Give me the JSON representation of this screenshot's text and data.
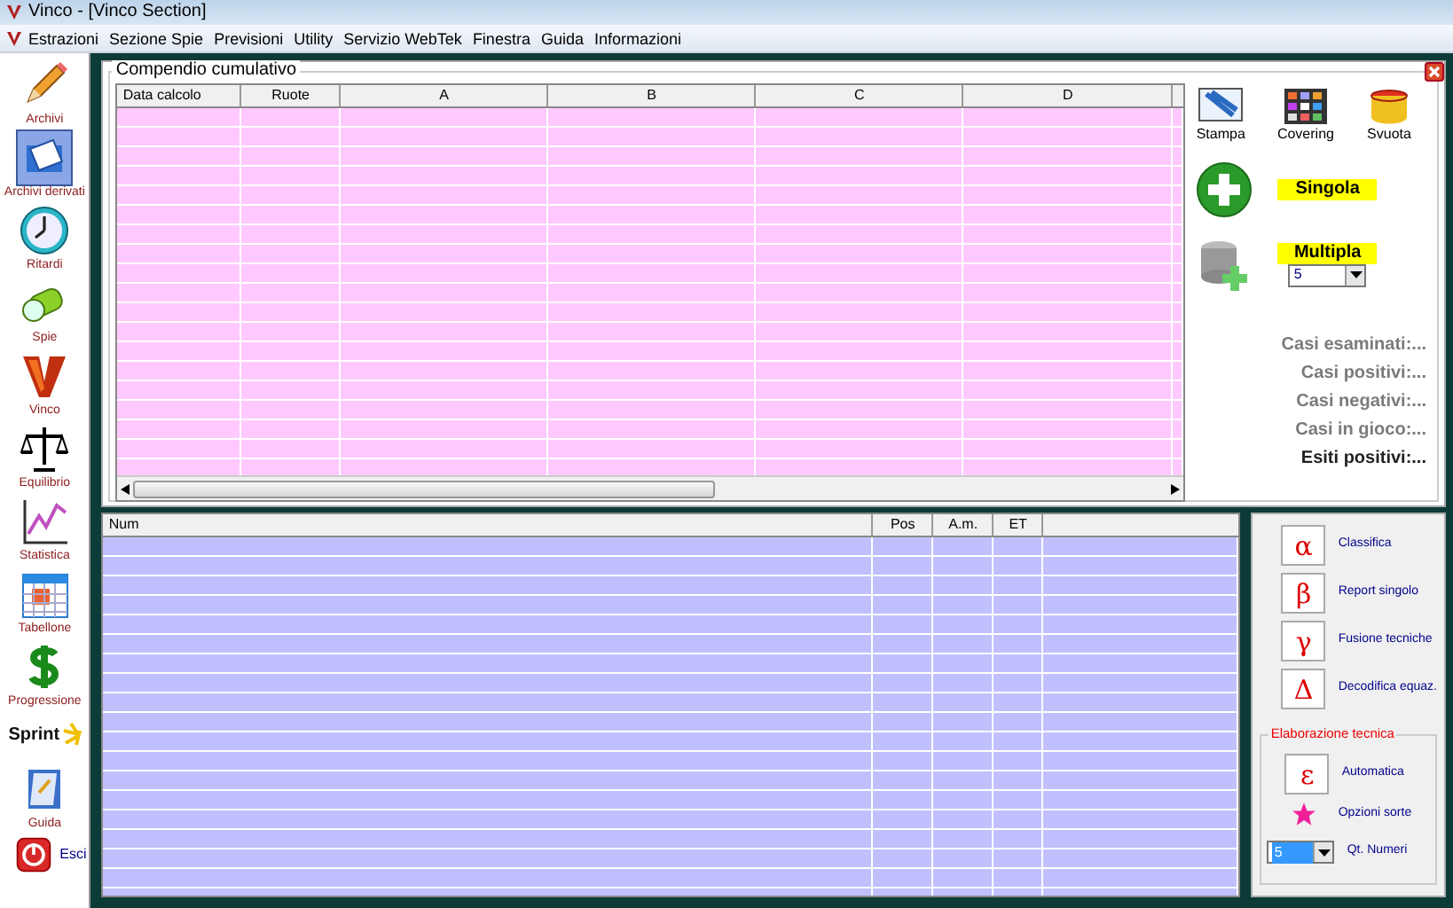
{
  "window": {
    "title": "Vinco - [Vinco Section]"
  },
  "menu": [
    "Estrazioni",
    "Sezione Spie",
    "Previsioni",
    "Utility",
    "Servizio WebTek",
    "Finestra",
    "Guida",
    "Informazioni"
  ],
  "sidebar": {
    "items": [
      {
        "label": "Archivi",
        "selected": false,
        "kind": "stacked"
      },
      {
        "label": "Archivi derivati",
        "selected": true,
        "kind": "stacked"
      },
      {
        "label": "Ritardi",
        "selected": false,
        "kind": "stacked"
      },
      {
        "label": "Spie",
        "selected": false,
        "kind": "stacked"
      },
      {
        "label": "Vinco",
        "selected": false,
        "kind": "stacked"
      },
      {
        "label": "Equilibrio",
        "selected": false,
        "kind": "stacked"
      },
      {
        "label": "Statistica",
        "selected": false,
        "kind": "stacked"
      },
      {
        "label": "Tabellone",
        "selected": false,
        "kind": "stacked"
      },
      {
        "label": "Progressione",
        "selected": false,
        "kind": "stacked"
      },
      {
        "label": "Sprint",
        "selected": false,
        "kind": "logo"
      },
      {
        "label": "Guida",
        "selected": false,
        "kind": "stacked"
      },
      {
        "label": "Esci",
        "selected": false,
        "kind": "inline"
      }
    ]
  },
  "panel": {
    "title": "Compendio cumulativo",
    "grid": {
      "columns": [
        "Data calcolo",
        "Ruote",
        "A",
        "B",
        "C",
        "D"
      ]
    },
    "toolbar": [
      "Stampa",
      "Covering",
      "Svuota"
    ],
    "actions": [
      {
        "label": "Singola"
      },
      {
        "label": "Multipla",
        "select": "5"
      }
    ],
    "stats": [
      {
        "text": "Casi esaminati:...",
        "emphasis": false
      },
      {
        "text": "Casi positivi:...",
        "emphasis": false
      },
      {
        "text": "Casi negativi:...",
        "emphasis": false
      },
      {
        "text": "Casi in gioco:...",
        "emphasis": false
      },
      {
        "text": "Esiti positivi:...",
        "emphasis": true
      }
    ]
  },
  "results": {
    "columns": [
      "Num",
      "Pos",
      "A.m.",
      "ET"
    ]
  },
  "techniques": {
    "items": [
      {
        "symbol": "α",
        "label": "Classifica"
      },
      {
        "symbol": "β",
        "label": "Report singolo"
      },
      {
        "symbol": "γ",
        "label": "Fusione tecniche"
      },
      {
        "symbol": "Δ",
        "label": "Decodifica equaz."
      }
    ],
    "group": {
      "title": "Elaborazione tecnica",
      "symbol": "ε",
      "label": "Automatica",
      "options_label": "Opzioni sorte",
      "select": "5",
      "select_label": "Qt. Numeri"
    }
  }
}
